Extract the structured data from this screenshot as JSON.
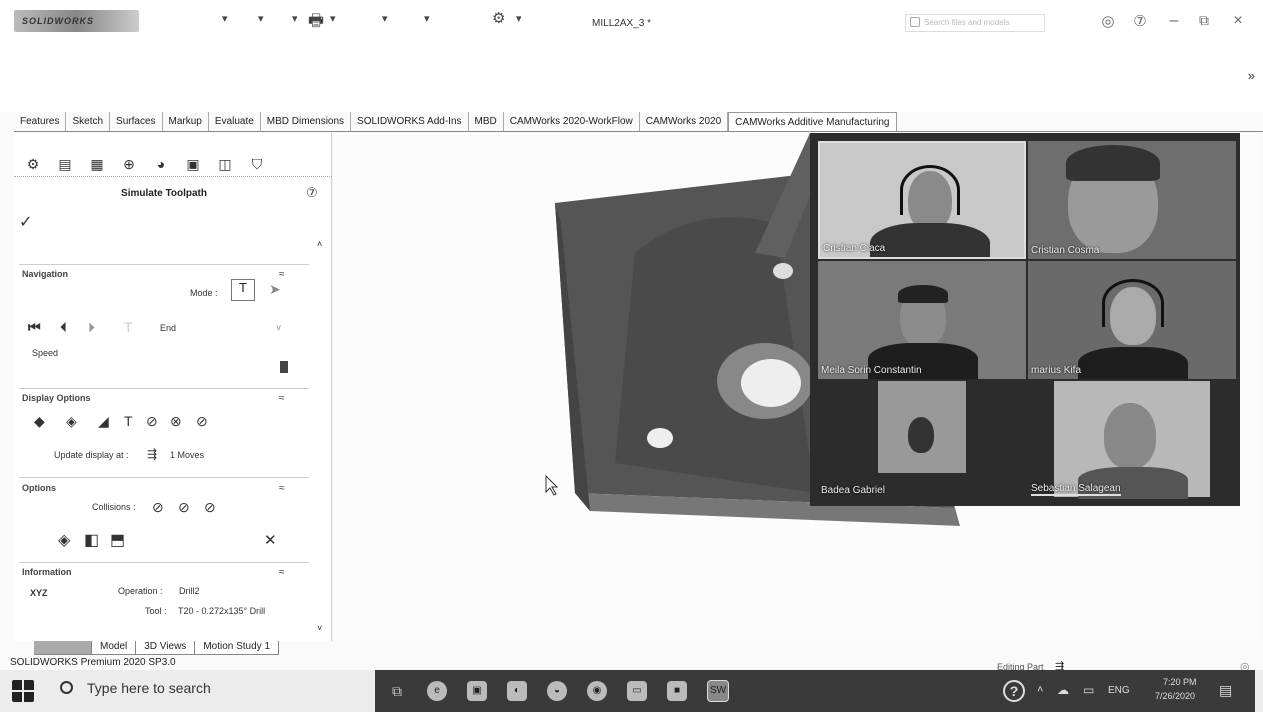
{
  "titlebar": {
    "logo": "SOLIDWORKS",
    "title": "MILL2AX_3 *",
    "search_placeholder": "Search files and models"
  },
  "cmd_tabs": [
    "Features",
    "Sketch",
    "Surfaces",
    "Markup",
    "Evaluate",
    "MBD Dimensions",
    "SOLIDWORKS Add-Ins",
    "MBD",
    "CAMWorks 2020-WorkFlow",
    "CAMWorks 2020",
    "CAMWorks Additive Manufacturing"
  ],
  "panel": {
    "title": "Simulate Toolpath",
    "navigation": {
      "header": "Navigation",
      "mode_label": "Mode :",
      "end_label": "End",
      "speed_label": "Speed"
    },
    "display_options": {
      "header": "Display Options",
      "update_label": "Update display at :",
      "update_value": "1 Moves"
    },
    "options": {
      "header": "Options",
      "collisions_label": "Collisions :"
    },
    "information": {
      "header": "Information",
      "xyz_label": "XYZ",
      "operation_label": "Operation :",
      "operation_value": "Drill2",
      "tool_label": "Tool :",
      "tool_value": "T20 - 0.272x135° Drill"
    }
  },
  "bottom_tabs": [
    "Model",
    "3D Views",
    "Motion Study 1"
  ],
  "status": {
    "left": "SOLIDWORKS Premium 2020 SP3.0",
    "editing": "Editing Part"
  },
  "participants": [
    {
      "name": "Cristian Ciaca"
    },
    {
      "name": "Cristian Cosma"
    },
    {
      "name": "Meila Sorin Constantin"
    },
    {
      "name": "marius Kifa"
    },
    {
      "name": "Badea Gabriel"
    },
    {
      "name": "Sebastian Salagean"
    }
  ],
  "taskbar": {
    "search_placeholder": "Type here to search",
    "language": "ENG",
    "time": "7:20 PM",
    "date": "7/26/2020"
  },
  "colors": {
    "part_dark": "#4a4a4a",
    "part_mid": "#5f5f5f",
    "video_bg": "#2c2c2c",
    "taskbar_dark": "#3a3a3a"
  }
}
